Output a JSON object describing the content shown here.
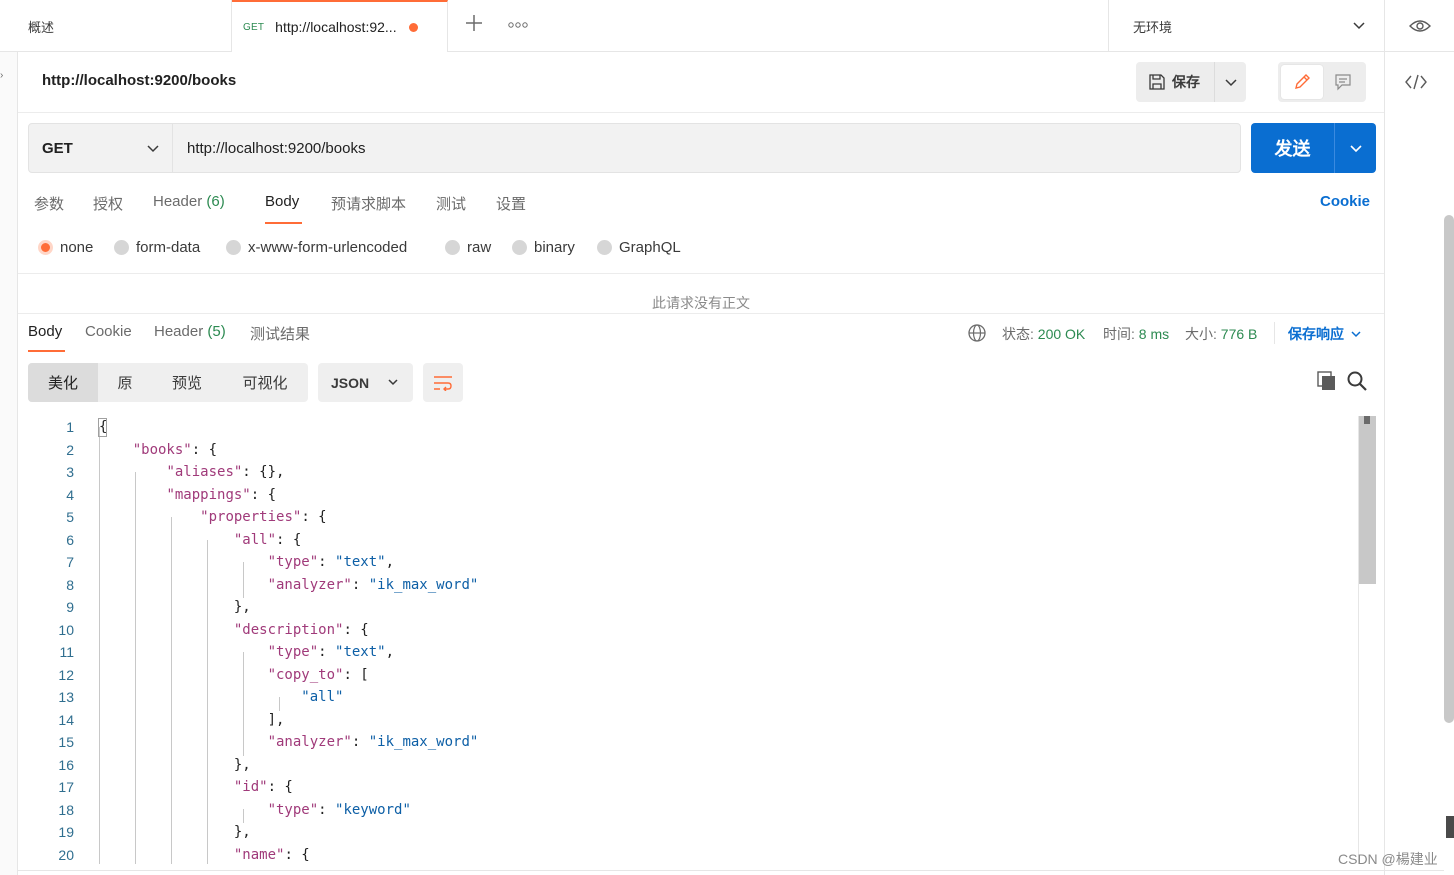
{
  "tabs": {
    "overview_label": "概述",
    "active_method": "GET",
    "active_url": "http://localhost:92...",
    "environment": "无环境"
  },
  "request": {
    "title": "http://localhost:9200/books",
    "save_label": "保存",
    "method": "GET",
    "url": "http://localhost:9200/books",
    "send_label": "发送",
    "tabs": [
      {
        "label": "参数"
      },
      {
        "label": "授权"
      },
      {
        "label": "Header",
        "count": "(6)"
      },
      {
        "label": "Body"
      },
      {
        "label": "预请求脚本"
      },
      {
        "label": "测试"
      },
      {
        "label": "设置"
      }
    ],
    "cookie_label": "Cookie",
    "body_types": [
      "none",
      "form-data",
      "x-www-form-urlencoded",
      "raw",
      "binary",
      "GraphQL"
    ],
    "selected_body_type": "none",
    "no_body_text": "此请求没有正文"
  },
  "response": {
    "tabs": [
      {
        "label": "Body"
      },
      {
        "label": "Cookie"
      },
      {
        "label": "Header",
        "count": "(5)"
      },
      {
        "label": "测试结果"
      }
    ],
    "status_label": "状态:",
    "status_value": "200 OK",
    "time_label": "时间:",
    "time_value": "8 ms",
    "size_label": "大小:",
    "size_value": "776 B",
    "save_response_label": "保存响应",
    "view_modes": [
      "美化",
      "原",
      "预览",
      "可视化"
    ],
    "format": "JSON"
  },
  "code_lines": [
    {
      "n": "1",
      "t": "{"
    },
    {
      "n": "2",
      "t": "    \"books\": {"
    },
    {
      "n": "3",
      "t": "        \"aliases\": {},"
    },
    {
      "n": "4",
      "t": "        \"mappings\": {"
    },
    {
      "n": "5",
      "t": "            \"properties\": {"
    },
    {
      "n": "6",
      "t": "                \"all\": {"
    },
    {
      "n": "7",
      "t": "                    \"type\": \"text\","
    },
    {
      "n": "8",
      "t": "                    \"analyzer\": \"ik_max_word\""
    },
    {
      "n": "9",
      "t": "                },"
    },
    {
      "n": "10",
      "t": "                \"description\": {"
    },
    {
      "n": "11",
      "t": "                    \"type\": \"text\","
    },
    {
      "n": "12",
      "t": "                    \"copy_to\": ["
    },
    {
      "n": "13",
      "t": "                        \"all\""
    },
    {
      "n": "14",
      "t": "                    ],"
    },
    {
      "n": "15",
      "t": "                    \"analyzer\": \"ik_max_word\""
    },
    {
      "n": "16",
      "t": "                },"
    },
    {
      "n": "17",
      "t": "                \"id\": {"
    },
    {
      "n": "18",
      "t": "                    \"type\": \"keyword\""
    },
    {
      "n": "19",
      "t": "                },"
    },
    {
      "n": "20",
      "t": "                \"name\": {"
    }
  ],
  "watermark": "CSDN @楊建业",
  "colors": {
    "accent": "#ff6c37",
    "primary": "#0a6ed1",
    "success": "#2c8a51",
    "json_key": "#a03a7a",
    "json_string": "#0d5fa6"
  }
}
